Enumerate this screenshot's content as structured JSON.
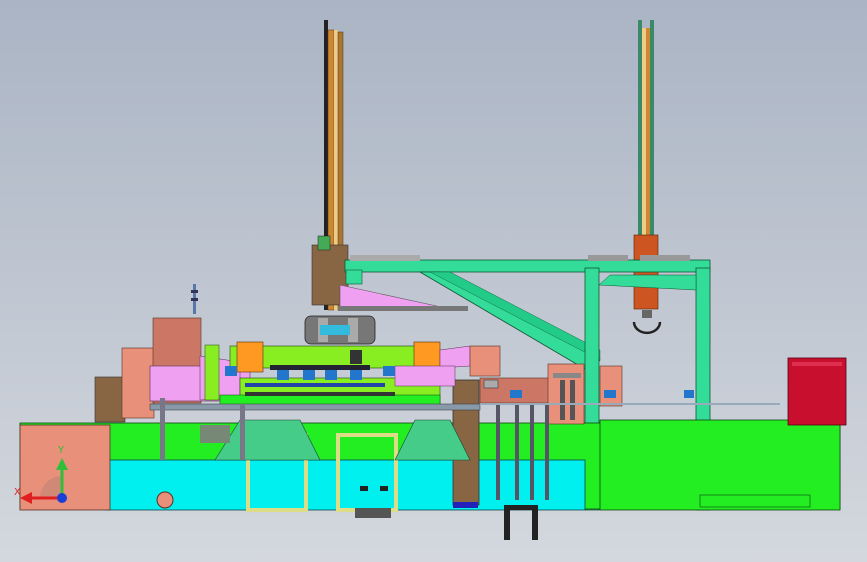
{
  "viewport": {
    "background_top": "#aab4c4",
    "background_bottom": "#d4d8de"
  },
  "triad": {
    "y_label": "Y",
    "x_label": "X",
    "y_color": "#2fbf3a",
    "x_color": "#e02020",
    "z_color": "#1a3fd6"
  },
  "colors": {
    "base_green": "#22ee22",
    "base_cyan": "#00f0f0",
    "frame_teal": "#33dd99",
    "roller_green": "#88ee22",
    "pink": "#f0a0f0",
    "orange": "#ff9922",
    "salmon": "#e8907a",
    "brown": "#886644",
    "crimson": "#c8102e",
    "khaki": "#dddd88",
    "blue": "#2277cc",
    "copper": "#cc6622"
  },
  "icons": [
    "axis-triad-icon"
  ]
}
